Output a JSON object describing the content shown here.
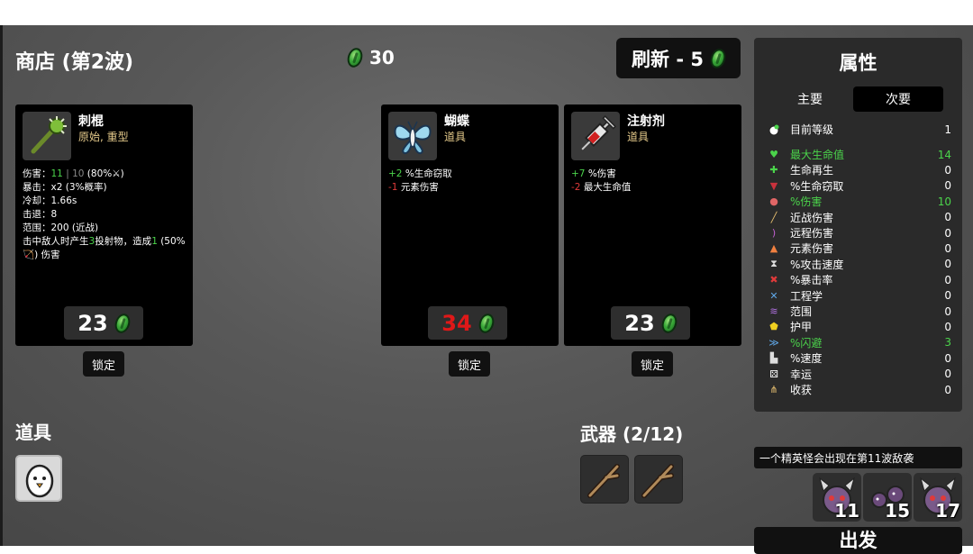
{
  "header": {
    "shop_title": "商店 (第2波)",
    "gold": "30",
    "reroll_label": "刷新 - 5"
  },
  "colors": {
    "accent_green": "#4bd44b",
    "negative_red": "#e03a3a",
    "tier_text": "#e3c98a"
  },
  "cards": [
    {
      "name": "刺棍",
      "type": "原始, 重型",
      "icon": "spiked-club-icon",
      "price": "23",
      "price_color": "#ffffff",
      "lock_label": "锁定",
      "stats": [
        {
          "label": "伤害：",
          "parts": [
            {
              "t": "11",
              "c": "g"
            },
            {
              "t": " | 10 ",
              "c": "gray"
            },
            {
              "t": "(80%",
              "c": ""
            },
            {
              "t": "⚔",
              "c": ""
            },
            {
              "t": ")",
              "c": ""
            }
          ]
        },
        {
          "label": "暴击：",
          "parts": [
            {
              "t": "x2 (3%概率)",
              "c": ""
            }
          ]
        },
        {
          "label": "冷却：",
          "parts": [
            {
              "t": "1.66s",
              "c": ""
            }
          ]
        },
        {
          "label": "击退：",
          "parts": [
            {
              "t": "8",
              "c": ""
            }
          ]
        },
        {
          "label": "范围：",
          "parts": [
            {
              "t": "200 (近战)",
              "c": ""
            }
          ]
        }
      ],
      "effect": [
        {
          "t": "击中敌人时产生",
          "c": ""
        },
        {
          "t": "3",
          "c": "g"
        },
        {
          "t": "投射物，造成",
          "c": ""
        },
        {
          "t": "1",
          "c": "g"
        },
        {
          "t": " (50%",
          "c": ""
        },
        {
          "t": "🏹",
          "c": ""
        },
        {
          "t": ") 伤害",
          "c": ""
        }
      ]
    },
    {
      "name": "蝴蝶",
      "type": "道具",
      "icon": "butterfly-icon",
      "price": "34",
      "price_color": "#e01818",
      "lock_label": "锁定",
      "effects": [
        [
          {
            "t": "+2",
            "c": "g"
          },
          {
            "t": " %生命窃取",
            "c": ""
          }
        ],
        [
          {
            "t": "-1",
            "c": "r"
          },
          {
            "t": " 元素伤害",
            "c": ""
          }
        ]
      ]
    },
    {
      "name": "注射剂",
      "type": "道具",
      "icon": "syringe-icon",
      "price": "23",
      "price_color": "#ffffff",
      "lock_label": "锁定",
      "effects": [
        [
          {
            "t": "+7",
            "c": "g"
          },
          {
            "t": " %伤害",
            "c": ""
          }
        ],
        [
          {
            "t": "-2",
            "c": "r"
          },
          {
            "t": " 最大生命值",
            "c": ""
          }
        ]
      ]
    }
  ],
  "items_section": {
    "title": "道具",
    "items": [
      {
        "icon": "egg-icon"
      }
    ]
  },
  "weapons_section": {
    "title": "武器 (2/12)",
    "items": [
      {
        "icon": "stick-icon"
      },
      {
        "icon": "stick-icon"
      }
    ]
  },
  "stats_panel": {
    "title": "属性",
    "tab_primary": "主要",
    "tab_secondary": "次要",
    "level": {
      "label": "目前等级",
      "value": "1"
    },
    "rows": [
      {
        "label": "最大生命值",
        "value": "14",
        "highlight": true,
        "icon": "heart-icon",
        "glyph": "♥",
        "color": "#4bd44b"
      },
      {
        "label": "生命再生",
        "value": "0",
        "highlight": false,
        "icon": "regen-icon",
        "glyph": "✚",
        "color": "#4bd44b"
      },
      {
        "label": "%生命窃取",
        "value": "0",
        "highlight": false,
        "icon": "fangs-icon",
        "glyph": "▼",
        "color": "#c8323c"
      },
      {
        "label": "%伤害",
        "value": "10",
        "highlight": true,
        "icon": "muscle-icon",
        "glyph": "●",
        "color": "#e06666"
      },
      {
        "label": "近战伤害",
        "value": "0",
        "highlight": false,
        "icon": "sword-icon",
        "glyph": "╱",
        "color": "#e8c070"
      },
      {
        "label": "远程伤害",
        "value": "0",
        "highlight": false,
        "icon": "bow-icon",
        "glyph": ")",
        "color": "#c060d0"
      },
      {
        "label": "元素伤害",
        "value": "0",
        "highlight": false,
        "icon": "flame-icon",
        "glyph": "▲",
        "color": "#f08040"
      },
      {
        "label": "%攻击速度",
        "value": "0",
        "highlight": false,
        "icon": "hourglass-icon",
        "glyph": "⧗",
        "color": "#dddddd"
      },
      {
        "label": "%暴击率",
        "value": "0",
        "highlight": false,
        "icon": "crit-icon",
        "glyph": "✖",
        "color": "#e03a3a"
      },
      {
        "label": "工程学",
        "value": "0",
        "highlight": false,
        "icon": "wrench-icon",
        "glyph": "✕",
        "color": "#60a8e8"
      },
      {
        "label": "范围",
        "value": "0",
        "highlight": false,
        "icon": "range-icon",
        "glyph": "≋",
        "color": "#b070e0"
      },
      {
        "label": "护甲",
        "value": "0",
        "highlight": false,
        "icon": "shield-icon",
        "glyph": "⬟",
        "color": "#f0d020"
      },
      {
        "label": "%闪避",
        "value": "3",
        "highlight": true,
        "icon": "dodge-icon",
        "glyph": "≫",
        "color": "#60a8e8"
      },
      {
        "label": "%速度",
        "value": "0",
        "highlight": false,
        "icon": "boot-icon",
        "glyph": "▙",
        "color": "#dddddd"
      },
      {
        "label": "幸运",
        "value": "0",
        "highlight": false,
        "icon": "dice-icon",
        "glyph": "⚄",
        "color": "#ffffff"
      },
      {
        "label": "收获",
        "value": "0",
        "highlight": false,
        "icon": "wheat-icon",
        "glyph": "⋔",
        "color": "#e8c070"
      }
    ]
  },
  "elite_notice": "一个精英怪会出现在第11波敌袭",
  "waves": [
    {
      "num": "11",
      "icon": "horned-elite-icon"
    },
    {
      "num": "15",
      "icon": "bomb-elite-icon"
    },
    {
      "num": "17",
      "icon": "horned-elite-icon"
    }
  ],
  "go_label": "出发"
}
